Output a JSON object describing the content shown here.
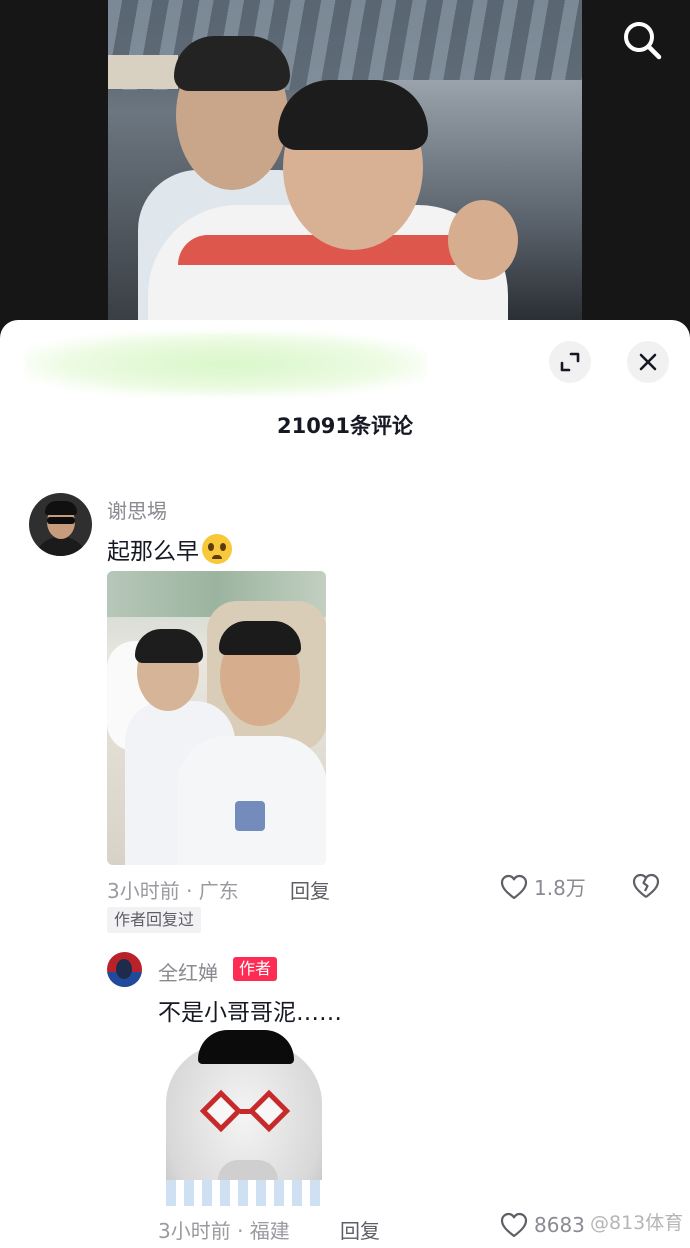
{
  "video": {
    "search_icon": "search-icon"
  },
  "sheet": {
    "count_title": "21091条评论",
    "expand_icon": "expand-icon",
    "close_icon": "close-icon"
  },
  "comments": [
    {
      "username": "谢思埸",
      "text": "起那么早",
      "emoji": "pleading-face-emoji",
      "meta": "3小时前 · 广东",
      "reply_label": "回复",
      "like_count": "1.8万",
      "author_replied": "作者回复过",
      "replies": [
        {
          "username": "全红婵",
          "badge": "作者",
          "text": "不是小哥哥泥……",
          "meta": "3小时前 · 福建",
          "reply_label": "回复",
          "like_count": "8683"
        }
      ]
    }
  ],
  "watermark": "@813体育",
  "colors": {
    "author_badge": "#fe2c55",
    "text_primary": "#161823",
    "text_secondary": "#8a8b91"
  }
}
